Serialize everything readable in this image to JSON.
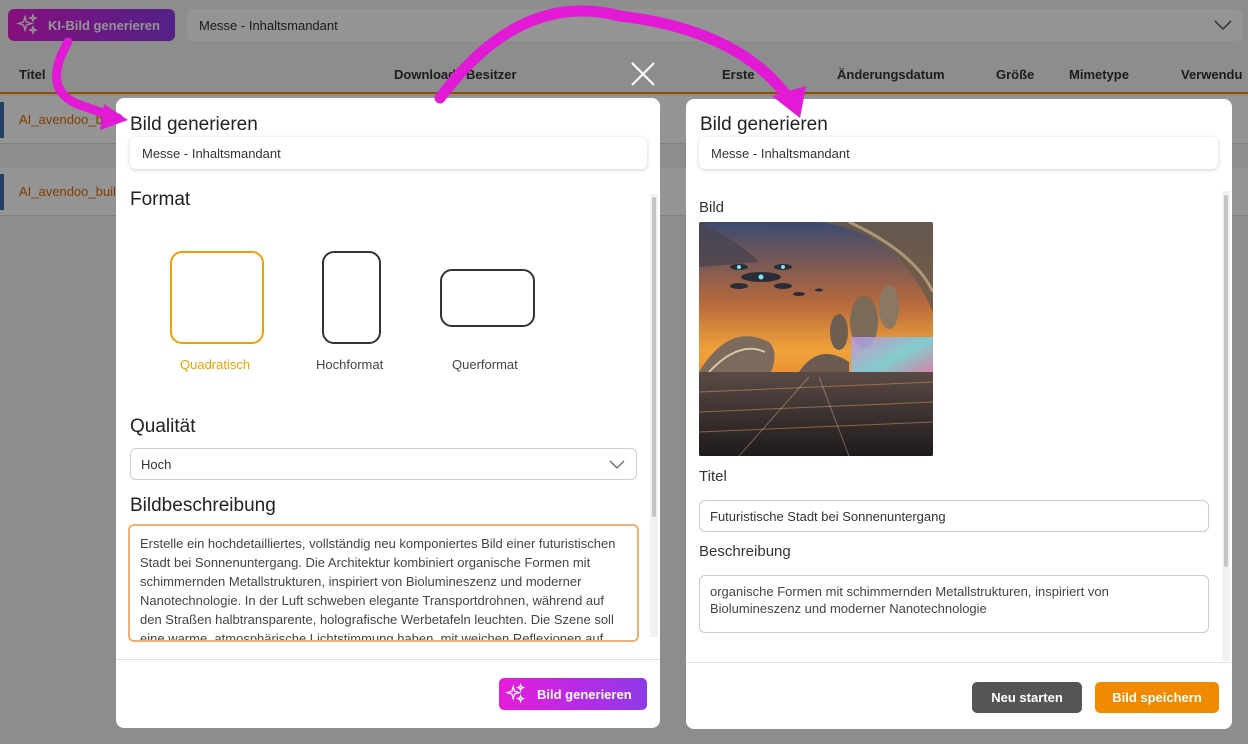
{
  "toolbar": {
    "ki_button_label": "KI-Bild generieren",
    "mandant_value": "Messe - Inhaltsmandant"
  },
  "table": {
    "columns": [
      "Titel",
      "Downloads",
      "Besitzer",
      "Erstellt",
      "Änderungsdatum",
      "Größe",
      "Mimetype",
      "Verwendung"
    ],
    "visible_headers": {
      "titel": "Titel",
      "downloads": "Download",
      "besitzer": "Besitzer",
      "erstellt": "Erste",
      "aenderungsdatum": "Änderungsdatum",
      "groesse": "Größe",
      "mimetype": "Mimetype",
      "verwendung": "Verwendu"
    },
    "rows": [
      {
        "title": "AI_avendoo_buil"
      },
      {
        "title": "AI_avendoo_buil"
      }
    ]
  },
  "left_dialog": {
    "title": "Bild generieren",
    "mandant_value": "Messe - Inhaltsmandant",
    "format_heading": "Format",
    "formats": [
      {
        "label": "Quadratisch",
        "selected": true
      },
      {
        "label": "Hochformat",
        "selected": false
      },
      {
        "label": "Querformat",
        "selected": false
      }
    ],
    "quality_heading": "Qualität",
    "quality_value": "Hoch",
    "description_heading": "Bildbeschreibung",
    "description_text": "Erstelle ein hochdetailliertes, vollständig neu komponiertes Bild einer futuristischen Stadt bei Sonnenuntergang. Die Architektur kombiniert organische Formen mit schimmernden Metallstrukturen, inspiriert von Biolumineszenz und moderner Nanotechnologie. In der Luft schweben elegante Transportdrohnen, während auf den Straßen halbtransparente, holografische Werbetafeln leuchten. Die Szene soll eine warme, atmosphärische Lichtstimmung haben, mit weichen Reflexionen auf",
    "generate_button_label": "Bild generieren"
  },
  "right_dialog": {
    "title": "Bild generieren",
    "mandant_value": "Messe - Inhaltsmandant",
    "image_label": "Bild",
    "title_label": "Titel",
    "title_value": "Futuristische Stadt bei Sonnenuntergang",
    "description_label": "Beschreibung",
    "description_value": "organische Formen mit schimmernden Metallstrukturen, inspiriert von Biolumineszenz und moderner Nanotechnologie",
    "restart_button_label": "Neu starten",
    "save_button_label": "Bild speichern"
  },
  "colors": {
    "accent_orange": "#f08a00",
    "selected_format": "#f0a000",
    "ki_gradient_start": "#e61cd8",
    "ki_gradient_end": "#8e3ae8",
    "arrow_magenta": "#e21ad6"
  },
  "icons": {
    "ki_button": "sparkles-icon",
    "dropdown": "chevron-down-icon",
    "close": "close-icon"
  }
}
